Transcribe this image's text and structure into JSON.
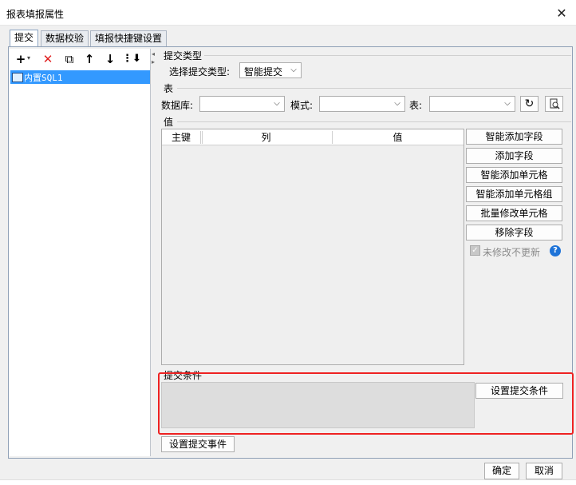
{
  "window": {
    "title": "报表填报属性",
    "close_glyph": "✕"
  },
  "tabs": [
    {
      "label": "提交",
      "active": true
    },
    {
      "label": "数据校验",
      "active": false
    },
    {
      "label": "填报快捷键设置",
      "active": false
    }
  ],
  "toolbar": {
    "add_glyph": "+",
    "add_caret": "▾",
    "delete_glyph": "✕",
    "copy_glyph": "⧉",
    "up_glyph": "↑",
    "down_glyph": "↓",
    "more_glyph": "⋮⬇"
  },
  "tree": {
    "items": [
      {
        "label": "内置SQL1"
      }
    ]
  },
  "submit_type": {
    "section_title": "提交类型",
    "label": "选择提交类型:",
    "selected": "智能提交"
  },
  "table": {
    "section_title": "表",
    "database_label": "数据库:",
    "database_value": "",
    "schema_label": "模式:",
    "schema_value": "",
    "table_label": "表:",
    "table_value": ""
  },
  "values": {
    "section_title": "值",
    "columns": [
      "主键",
      "列",
      "值"
    ],
    "rows": [],
    "buttons": [
      "智能添加字段",
      "添加字段",
      "智能添加单元格",
      "智能添加单元格组",
      "批量修改单元格",
      "移除字段"
    ],
    "no_update_label": "未修改不更新",
    "no_update_checked": true
  },
  "condition": {
    "section_title": "提交条件",
    "set_button": "设置提交条件"
  },
  "event_button": "设置提交事件",
  "footer": {
    "ok": "确定",
    "cancel": "取消"
  }
}
